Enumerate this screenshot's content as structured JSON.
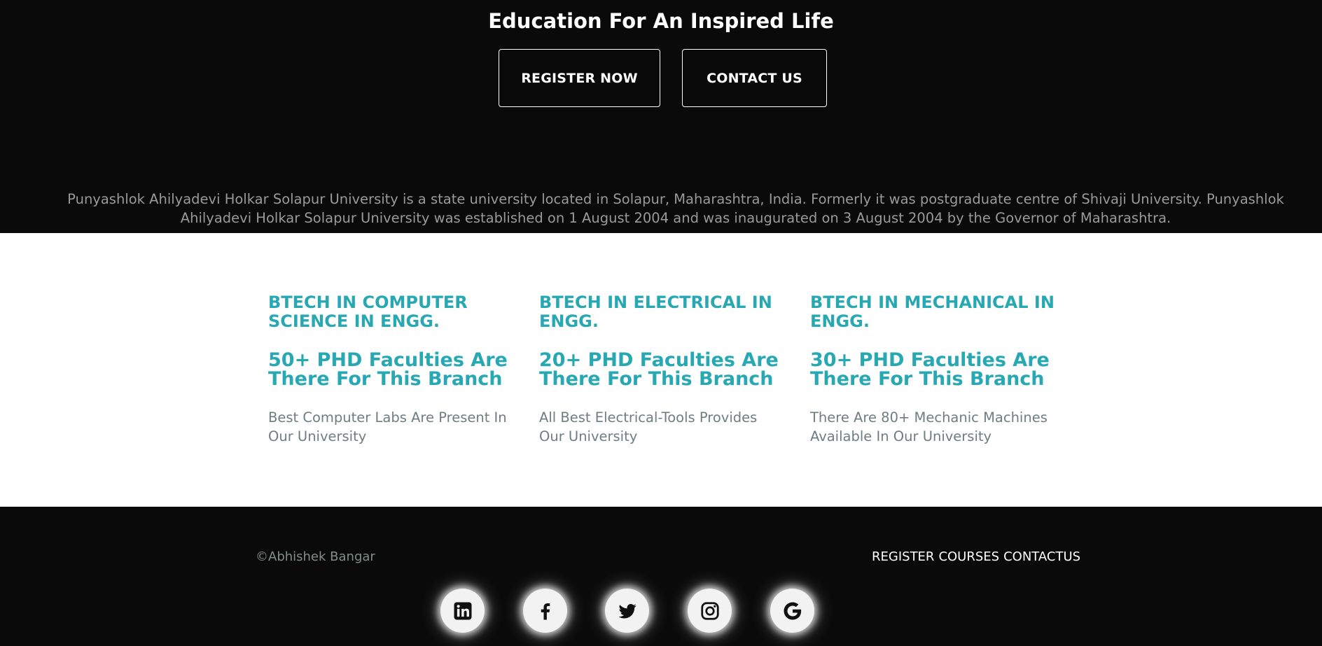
{
  "hero": {
    "tagline": "Education For An Inspired Life",
    "register_label": "REGISTER NOW",
    "contact_label": "CONTACT US",
    "about": "Punyashlok Ahilyadevi Holkar Solapur University is a state university located in Solapur, Maharashtra, India. Formerly it was postgraduate centre of Shivaji University. Punyashlok Ahilyadevi Holkar Solapur University was established on 1 August 2004 and was inaugurated on 3 August 2004 by the Governor of Maharashtra."
  },
  "courses": [
    {
      "title": "BTECH IN COMPUTER SCIENCE IN ENGG.",
      "faculties": "50+ PHD Faculties Are There For This Branch",
      "description": "Best Computer Labs Are Present In Our University"
    },
    {
      "title": "BTECH IN ELECTRICAL IN ENGG.",
      "faculties": "20+ PHD Faculties Are There For This Branch",
      "description": "All Best Electrical-Tools Provides Our University"
    },
    {
      "title": "BTECH IN MECHANICAL IN ENGG.",
      "faculties": "30+ PHD Faculties Are There For This Branch",
      "description": "There Are 80+ Mechanic Machines Available In Our University"
    }
  ],
  "footer": {
    "copyright": "©Abhishek Bangar",
    "nav": [
      "REGISTER",
      "COURSES",
      "CONTACTUS"
    ],
    "social_icons": [
      "linkedin-icon",
      "facebook-icon",
      "twitter-icon",
      "instagram-icon",
      "google-icon"
    ]
  },
  "colors": {
    "background_dark": "#0a0a0a",
    "accent_teal": "#27a8b3",
    "muted_text": "#6e7e80"
  }
}
